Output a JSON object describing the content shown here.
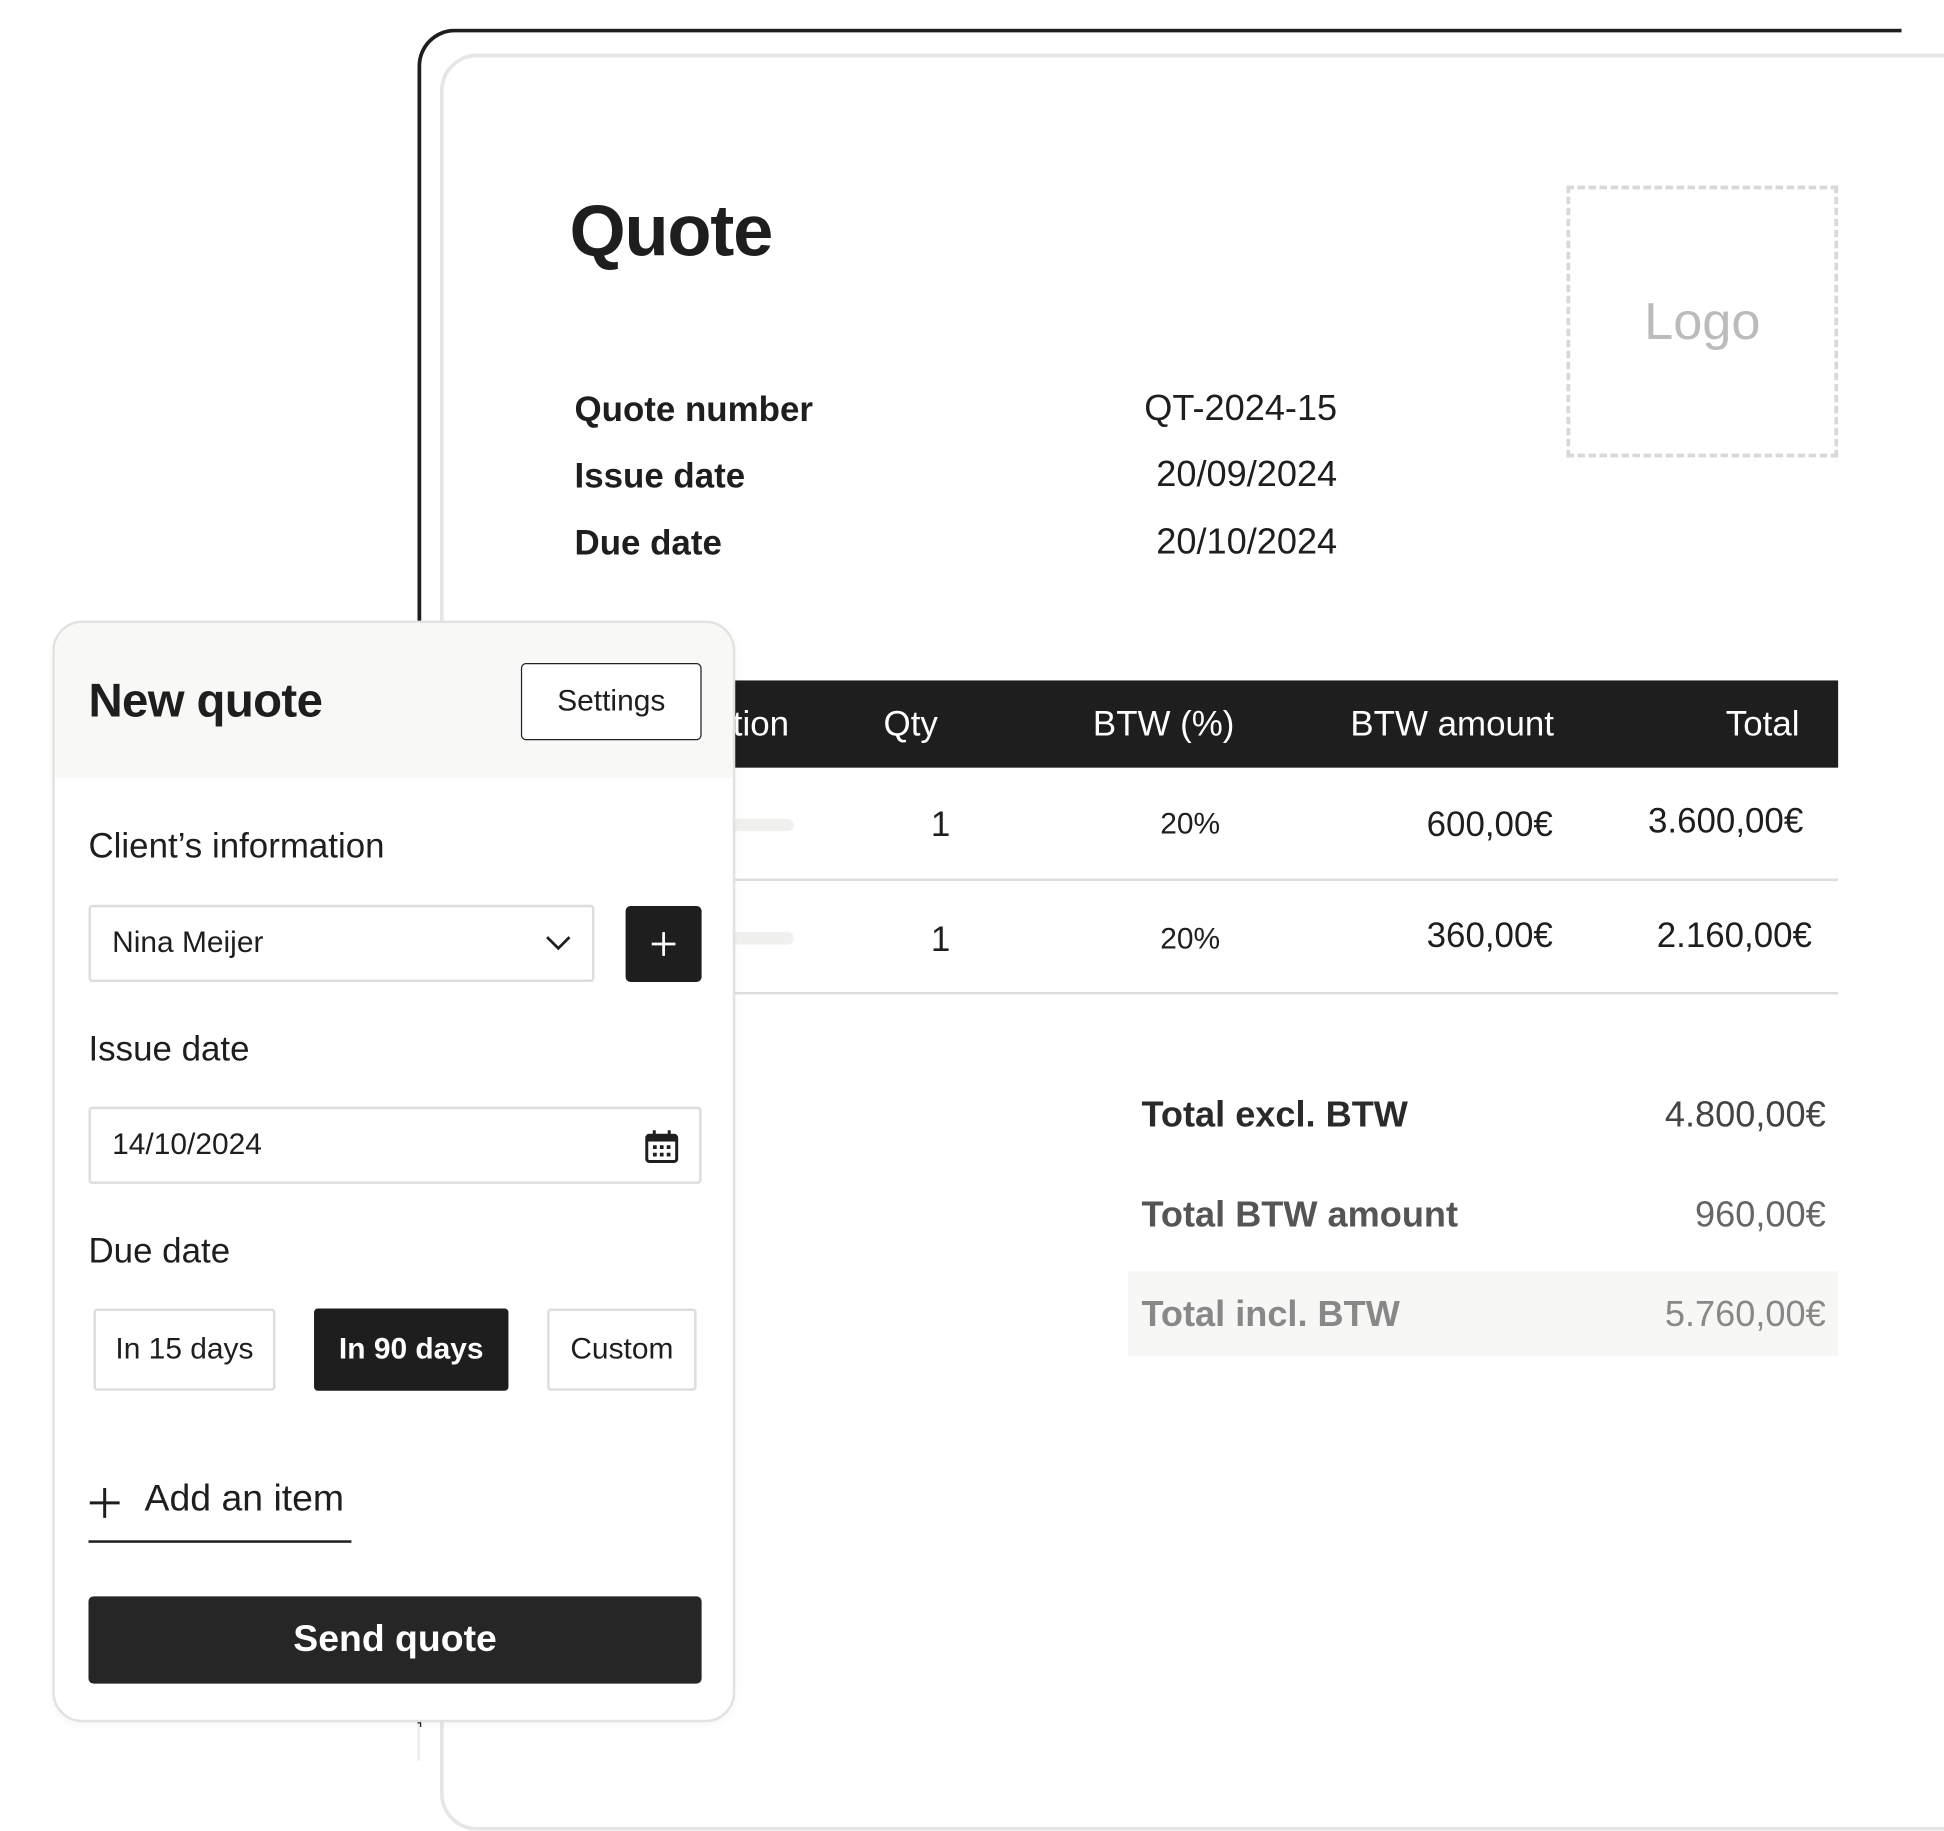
{
  "document": {
    "title": "Quote",
    "logo_placeholder": "Logo",
    "meta": [
      {
        "label": "Quote number",
        "value": "QT-2024-15"
      },
      {
        "label": "Issue date",
        "value": "20/09/2024"
      },
      {
        "label": "Due date",
        "value": "20/10/2024"
      }
    ],
    "table": {
      "headers": {
        "description": "Description",
        "description_visible": "tion",
        "qty": "Qty",
        "btw_pct": "BTW (%)",
        "btw_amount": "BTW amount",
        "total": "Total"
      },
      "rows": [
        {
          "qty": "1",
          "btw_pct": "20%",
          "btw_amount": "600,00€",
          "total": "3.600,00€"
        },
        {
          "qty": "1",
          "btw_pct": "20%",
          "btw_amount": "360,00€",
          "total": "2.160,00€"
        }
      ]
    },
    "totals": [
      {
        "label": "Total excl. BTW",
        "value": "4.800,00€"
      },
      {
        "label": "Total BTW amount",
        "value": "960,00€"
      },
      {
        "label": "Total incl. BTW",
        "value": "5.760,00€"
      }
    ]
  },
  "panel": {
    "title": "New quote",
    "settings_label": "Settings",
    "client_label": "Client’s information",
    "client_value": "Nina Meijer",
    "add_client_icon": "plus-icon",
    "issue_date_label": "Issue date",
    "issue_date_value": "14/10/2024",
    "due_date_label": "Due date",
    "due_options": [
      {
        "label": "In 15 days",
        "selected": false
      },
      {
        "label": "In 90 days",
        "selected": true
      },
      {
        "label": "Custom",
        "selected": false
      }
    ],
    "add_item_label": "Add an item",
    "send_label": "Send quote"
  },
  "colors": {
    "accent": "#1e1e1e",
    "panel_header_bg": "#f8f8f6"
  }
}
